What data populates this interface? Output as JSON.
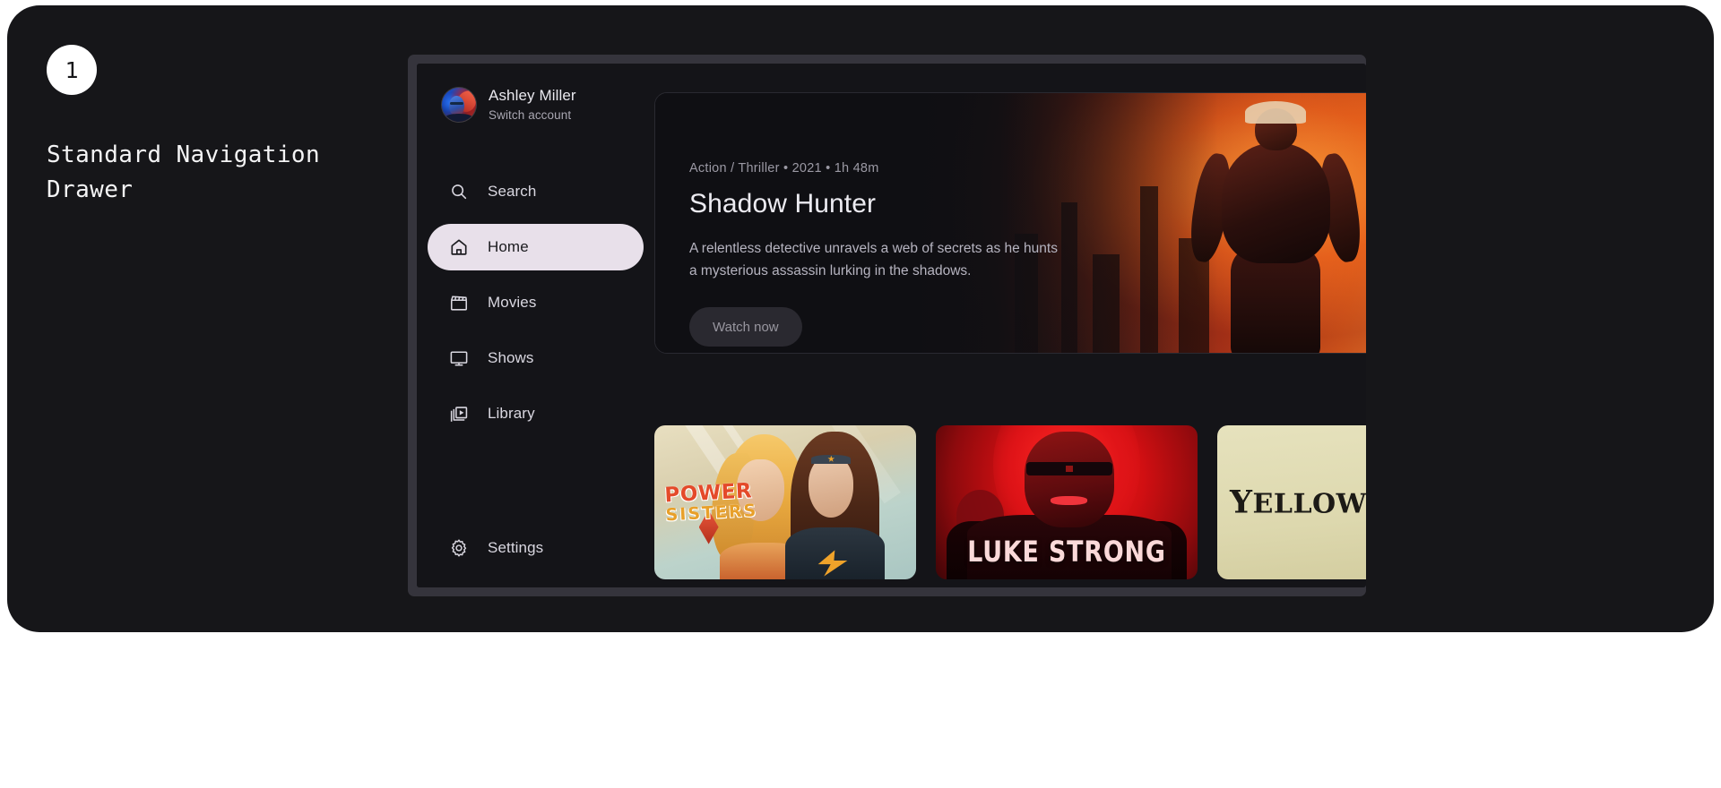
{
  "annotation": {
    "step_number": "1",
    "title": "Standard Navigation Drawer"
  },
  "drawer": {
    "account": {
      "name": "Ashley Miller",
      "action": "Switch account",
      "avatar_icon": "user-avatar"
    },
    "items": [
      {
        "label": "Search",
        "icon": "search-icon",
        "active": false
      },
      {
        "label": "Home",
        "icon": "home-icon",
        "active": true
      },
      {
        "label": "Movies",
        "icon": "movie-icon",
        "active": false
      },
      {
        "label": "Shows",
        "icon": "tv-icon",
        "active": false
      },
      {
        "label": "Library",
        "icon": "library-icon",
        "active": false
      }
    ],
    "bottom_item": {
      "label": "Settings",
      "icon": "gear-icon",
      "active": false
    }
  },
  "hero": {
    "meta": "Action / Thriller • 2021 • 1h 48m",
    "title": "Shadow Hunter",
    "description": "A relentless detective unravels a web of secrets as he hunts a mysterious assassin lurking in the shadows.",
    "cta_label": "Watch now"
  },
  "cards": [
    {
      "id": "power-sisters",
      "title_line1": "POWER",
      "title_line2": "SISTERS"
    },
    {
      "id": "luke-strong",
      "title": "LUKE STRONG"
    },
    {
      "id": "yellow",
      "title_first": "Y",
      "title_rest": "ELLOW"
    }
  ],
  "colors": {
    "active_pill": "#e8e0ea",
    "app_background": "#141418",
    "window_frame": "#35343c",
    "canvas": "#161619",
    "accent_red": "#d10f12",
    "accent_orange": "#e0631f"
  }
}
